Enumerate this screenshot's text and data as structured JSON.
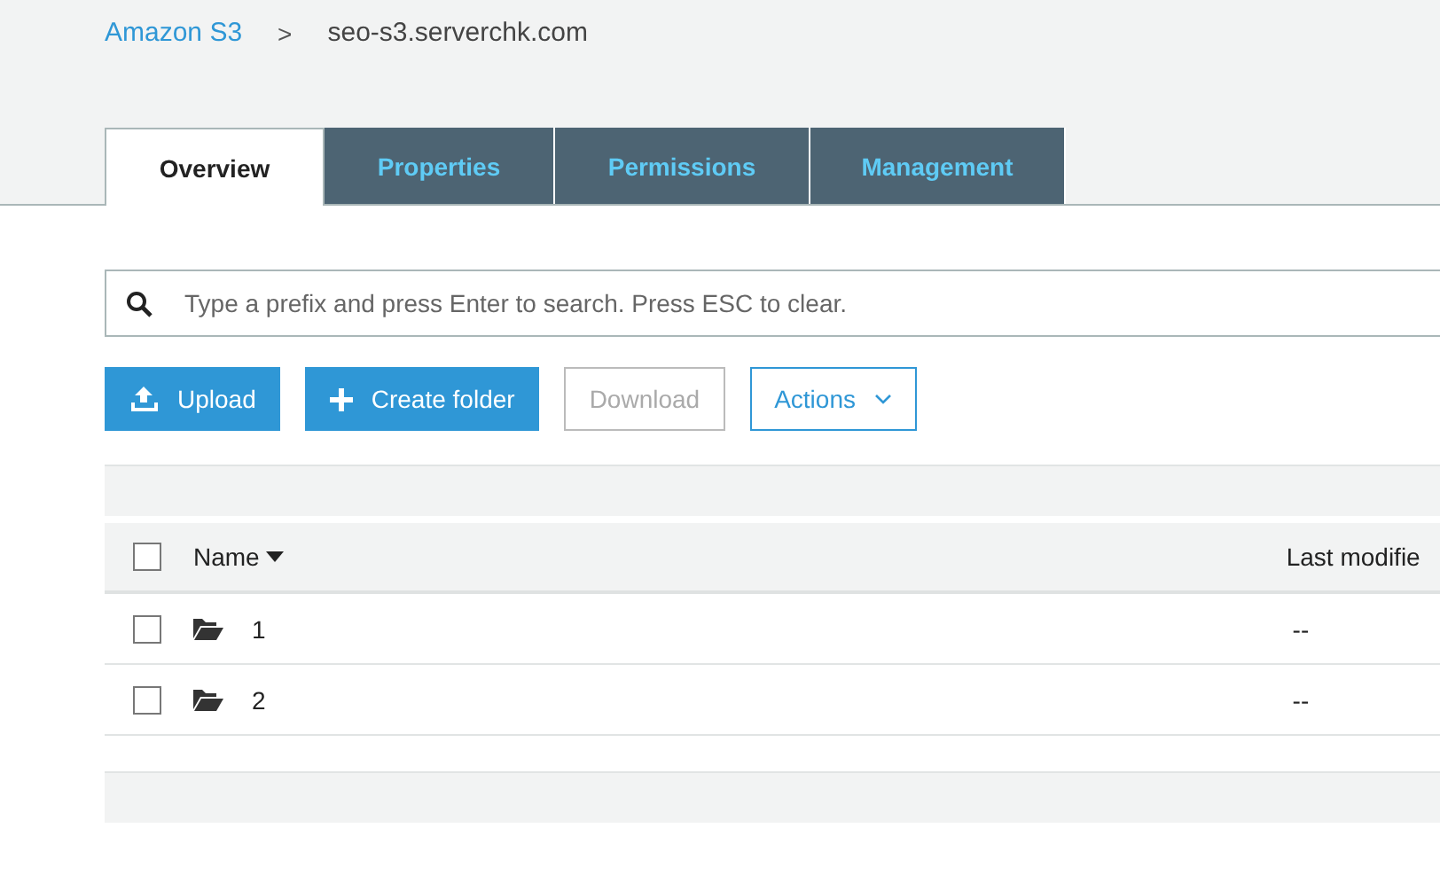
{
  "breadcrumb": [
    {
      "label": "Amazon S3",
      "kind": "link"
    },
    {
      "label": "seo-s3.serverchk.com",
      "kind": "current"
    }
  ],
  "breadcrumb_separator": ">",
  "tabs": [
    {
      "label": "Overview",
      "selected": true
    },
    {
      "label": "Properties",
      "selected": false
    },
    {
      "label": "Permissions",
      "selected": false
    },
    {
      "label": "Management",
      "selected": false
    }
  ],
  "search": {
    "placeholder": "Type a prefix and press Enter to search. Press ESC to clear."
  },
  "toolbar": [
    {
      "kind": "upload",
      "label": "Upload"
    },
    {
      "kind": "create",
      "label": "Create folder"
    },
    {
      "kind": "plain",
      "label": "Download",
      "disabled": true
    },
    {
      "kind": "menu",
      "label": "Actions"
    }
  ],
  "table": {
    "columns": [
      "Name",
      "Last modifie"
    ],
    "header_checked": false,
    "rows": [
      {
        "name": "1",
        "last_modified": "--",
        "checked": false
      },
      {
        "name": "2",
        "last_modified": "--",
        "checked": false
      }
    ]
  }
}
